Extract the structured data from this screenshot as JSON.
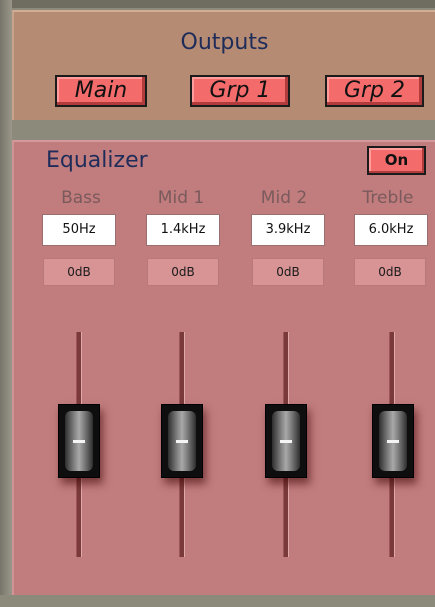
{
  "outputs": {
    "title": "Outputs",
    "buttons": [
      "Main",
      "Grp 1",
      "Grp 2"
    ]
  },
  "equalizer": {
    "title": "Equalizer",
    "toggle_label": "On",
    "bands": [
      {
        "name": "Bass",
        "freq": "50Hz",
        "gain": "0dB",
        "level": 0.5
      },
      {
        "name": "Mid 1",
        "freq": "1.4kHz",
        "gain": "0dB",
        "level": 0.5
      },
      {
        "name": "Mid 2",
        "freq": "3.9kHz",
        "gain": "0dB",
        "level": 0.5
      },
      {
        "name": "Treble",
        "freq": "6.0kHz",
        "gain": "0dB",
        "level": 0.5
      }
    ]
  },
  "colors": {
    "button_red": "#f36b6b",
    "title_blue": "#1e2c5a",
    "eq_panel": "#c17c7d",
    "outputs_panel": "#b58b73"
  }
}
